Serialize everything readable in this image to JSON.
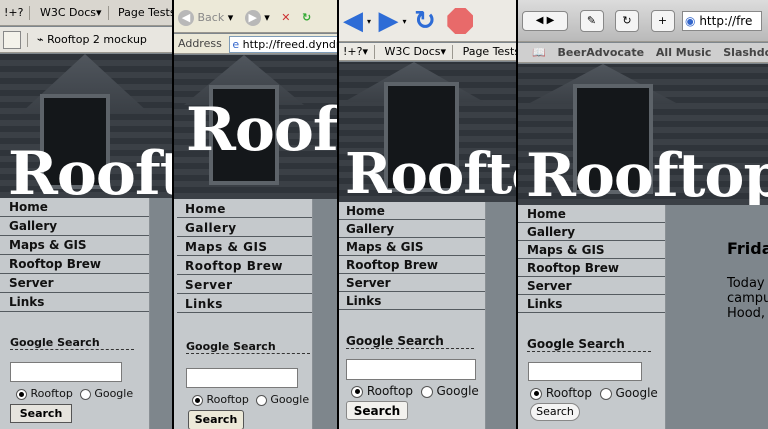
{
  "site": {
    "title": "Rooftop",
    "p4_title": "Rooftop"
  },
  "nav": [
    "Home",
    "Gallery",
    "Maps & GIS",
    "Rooftop Brew",
    "Server",
    "Links"
  ],
  "search": {
    "title": "Google Search",
    "opt1": "Rooftop",
    "opt2": "Google",
    "button": "Search"
  },
  "p1": {
    "toolbar1": [
      "!+?",
      "W3C Docs",
      "Page Tests"
    ],
    "tab_label": "Rooftop 2 mockup"
  },
  "p2": {
    "back": "Back",
    "address_label": "Address",
    "url": "http://freed.dyndns"
  },
  "p3": {
    "toolbar": [
      "!+?",
      "W3C Docs",
      "Page Tests"
    ]
  },
  "p4": {
    "url": "http://fre",
    "bookmarks": [
      "BeerAdvocate",
      "All Music",
      "Slashdo"
    ],
    "content_heading": "Frida",
    "content_lines": [
      "Today",
      "campu",
      "Hood,"
    ]
  }
}
